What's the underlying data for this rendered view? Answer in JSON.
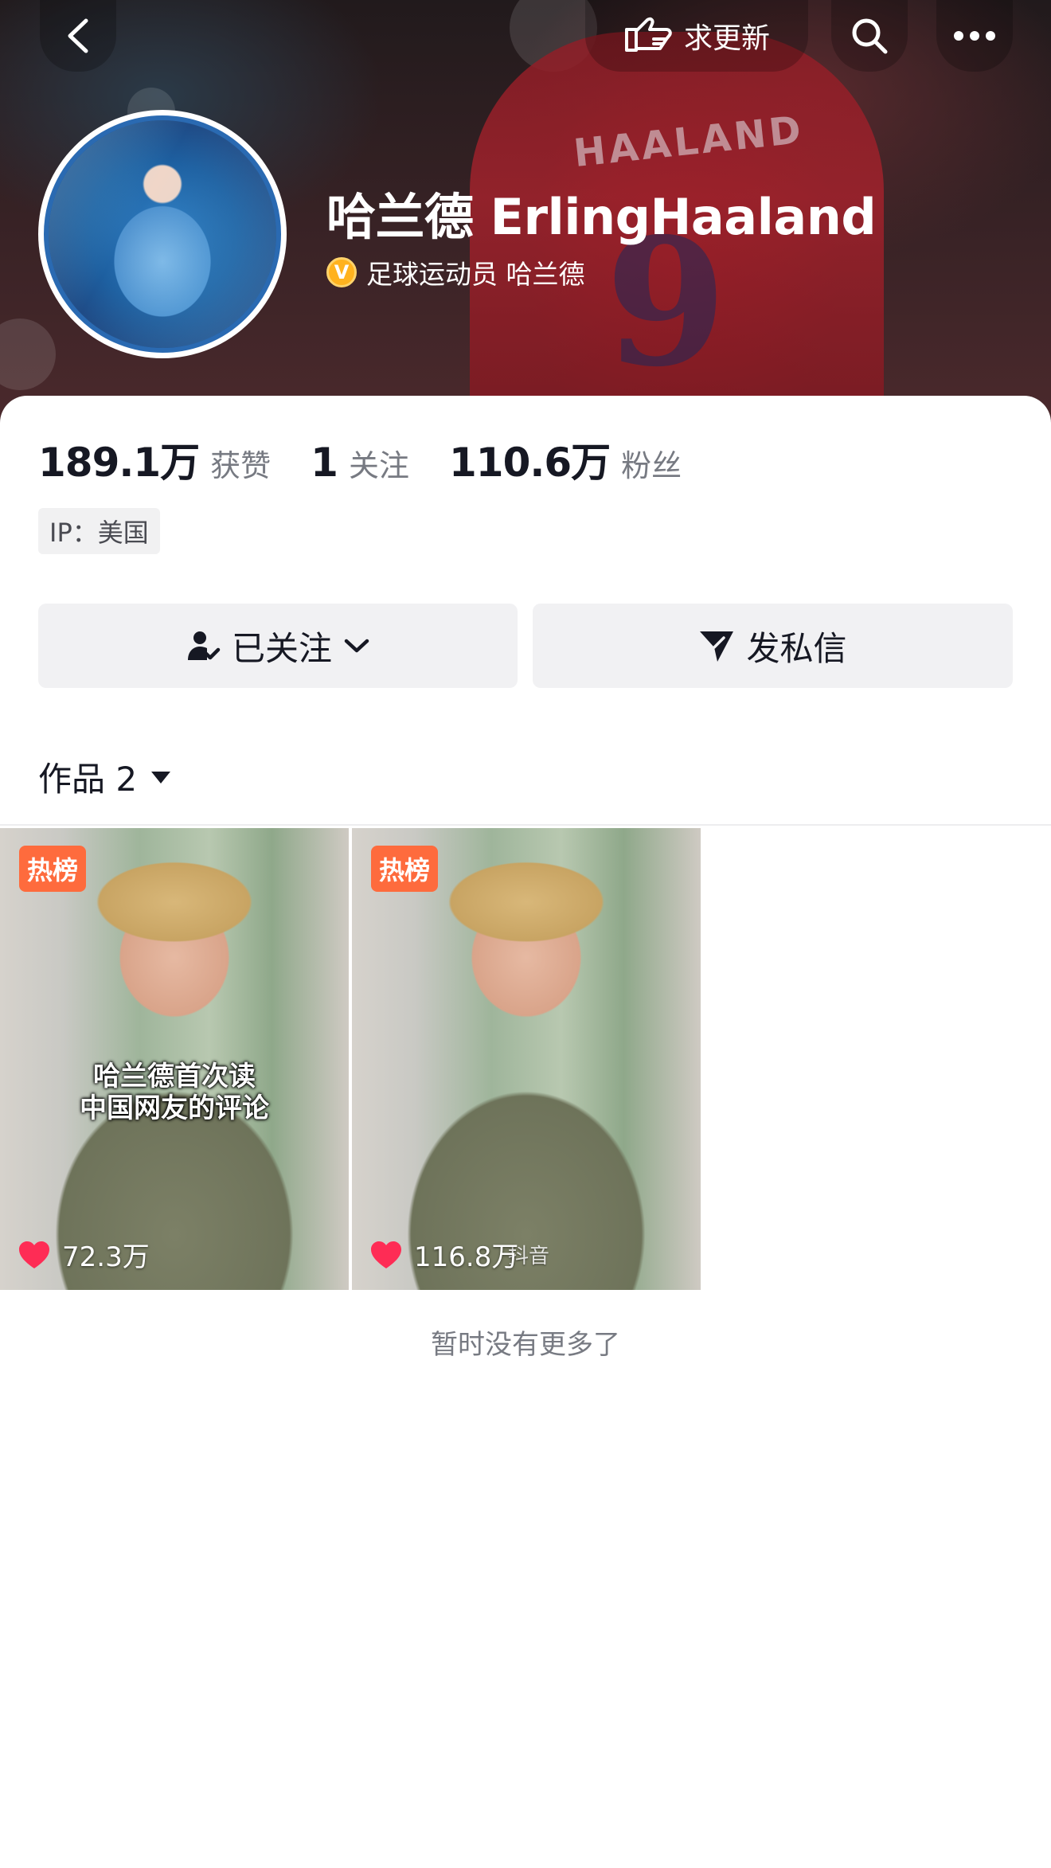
{
  "header": {
    "request_update_label": "求更新",
    "nickname": "哈兰德 ErlingHaaland",
    "verified_label": "足球运动员 哈兰德",
    "verified_badge": "V",
    "jersey_name": "HAALAND",
    "jersey_number": "9"
  },
  "stats": [
    {
      "value": "189.1万",
      "label": "获赞"
    },
    {
      "value": "1",
      "label": "关注"
    },
    {
      "value": "110.6万",
      "label": "粉丝"
    }
  ],
  "ip_location": "IP：美国",
  "actions": {
    "follow_label": "已关注",
    "message_label": "发私信"
  },
  "works": {
    "tab_label": "作品 2",
    "items": [
      {
        "badge": "热榜",
        "caption_line1": "哈兰德首次读",
        "caption_line2": "中国网友的评论",
        "likes": "72.3万",
        "watermark": ""
      },
      {
        "badge": "热榜",
        "caption_line1": "",
        "caption_line2": "",
        "likes": "116.8万",
        "watermark": "抖音"
      }
    ],
    "end_text": "暂时没有更多了"
  },
  "colors": {
    "accent_like": "#fe2c55",
    "hot_badge": "#fe6b3d",
    "verify_badge": "#ffb21e"
  },
  "icons": [
    "back-icon",
    "request-update-icon",
    "search-icon",
    "more-icon",
    "follow-person-icon",
    "chevron-down-icon",
    "send-icon",
    "caret-down-icon",
    "heart-icon"
  ]
}
